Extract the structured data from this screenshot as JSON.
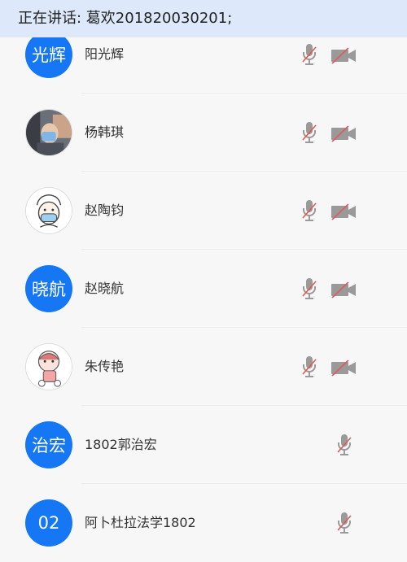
{
  "banner": {
    "text": "正在讲话: 葛欢201820030201;"
  },
  "participants": [
    {
      "name": "阳光辉",
      "avatar_text": "光辉",
      "avatar_type": "text",
      "mic": "muted-icon",
      "camera": "camera-off-icon"
    },
    {
      "name": "杨韩琪",
      "avatar_type": "photo",
      "mic": "muted-icon",
      "camera": "camera-off-icon"
    },
    {
      "name": "赵陶钧",
      "avatar_type": "photo",
      "mic": "muted-icon",
      "camera": "camera-off-icon"
    },
    {
      "name": "赵晓航",
      "avatar_text": "晓航",
      "avatar_type": "text",
      "mic": "muted-icon",
      "camera": "camera-off-icon"
    },
    {
      "name": "朱传艳",
      "avatar_type": "photo",
      "mic": "muted-icon",
      "camera": "camera-off-icon"
    },
    {
      "name": "1802郭治宏",
      "avatar_text": "治宏",
      "avatar_type": "text",
      "mic": "muted-icon"
    },
    {
      "name": "阿卜杜拉法学1802",
      "avatar_text": "02",
      "avatar_type": "text",
      "mic": "muted-icon"
    }
  ],
  "colors": {
    "accent": "#1677f5",
    "banner_bg": "#dde9fa",
    "muted_slash": "#e05a5a",
    "icon_gray": "#9a9a9a"
  }
}
